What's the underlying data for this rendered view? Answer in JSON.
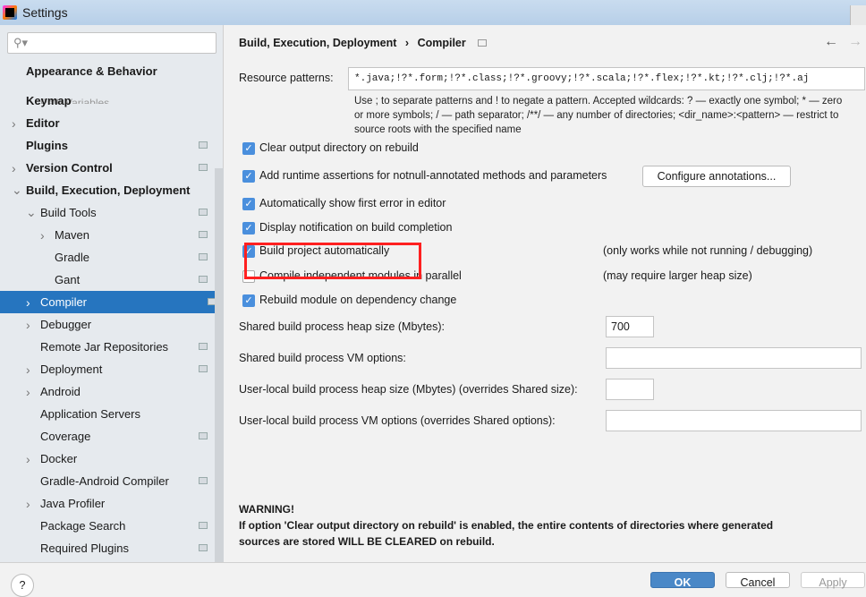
{
  "window": {
    "title": "Settings"
  },
  "sidebar": {
    "search_placeholder": "",
    "ghost": "Path Variables",
    "items": [
      {
        "label": "Appearance & Behavior",
        "bold": true,
        "indent": 0,
        "arrow": false,
        "icon": false
      },
      {
        "label": "Keymap",
        "bold": true,
        "indent": 0,
        "arrow": false,
        "icon": false
      },
      {
        "label": "Editor",
        "bold": true,
        "indent": 0,
        "arrow": "right",
        "icon": false
      },
      {
        "label": "Plugins",
        "bold": true,
        "indent": 0,
        "arrow": false,
        "icon": true
      },
      {
        "label": "Version Control",
        "bold": true,
        "indent": 0,
        "arrow": "right",
        "icon": true
      },
      {
        "label": "Build, Execution, Deployment",
        "bold": true,
        "indent": 0,
        "arrow": "down",
        "icon": false
      },
      {
        "label": "Build Tools",
        "indent": 1,
        "arrow": "down",
        "icon": true
      },
      {
        "label": "Maven",
        "indent": 2,
        "arrow": "right",
        "icon": true
      },
      {
        "label": "Gradle",
        "indent": 2,
        "arrow": false,
        "icon": true
      },
      {
        "label": "Gant",
        "indent": 2,
        "arrow": false,
        "icon": true
      },
      {
        "label": "Compiler",
        "indent": 1,
        "arrow": "right",
        "icon": true,
        "selected": true
      },
      {
        "label": "Debugger",
        "indent": 1,
        "arrow": "right",
        "icon": false
      },
      {
        "label": "Remote Jar Repositories",
        "indent": 1,
        "arrow": false,
        "icon": true
      },
      {
        "label": "Deployment",
        "indent": 1,
        "arrow": "right",
        "icon": true
      },
      {
        "label": "Android",
        "indent": 1,
        "arrow": "right",
        "icon": false
      },
      {
        "label": "Application Servers",
        "indent": 1,
        "arrow": false,
        "icon": false
      },
      {
        "label": "Coverage",
        "indent": 1,
        "arrow": false,
        "icon": true
      },
      {
        "label": "Docker",
        "indent": 1,
        "arrow": "right",
        "icon": false
      },
      {
        "label": "Gradle-Android Compiler",
        "indent": 1,
        "arrow": false,
        "icon": true
      },
      {
        "label": "Java Profiler",
        "indent": 1,
        "arrow": "right",
        "icon": false
      },
      {
        "label": "Package Search",
        "indent": 1,
        "arrow": false,
        "icon": true
      },
      {
        "label": "Required Plugins",
        "indent": 1,
        "arrow": false,
        "icon": true
      }
    ]
  },
  "breadcrumb": {
    "parent": "Build, Execution, Deployment",
    "sep": "›",
    "current": "Compiler"
  },
  "resource": {
    "label": "Resource patterns:",
    "value": "*.java;!?*.form;!?*.class;!?*.groovy;!?*.scala;!?*.flex;!?*.kt;!?*.clj;!?*.aj",
    "help": [
      "Use ; to separate patterns and ! to negate a pattern. Accepted wildcards: ? — exactly one symbol; * — zero",
      "or more symbols; / — path separator; /**/ — any number of directories;  <dir_name>:<pattern> — restrict to",
      "source roots with the specified name"
    ]
  },
  "options": [
    {
      "label": "Clear output directory on rebuild",
      "checked": true
    },
    {
      "label": "Add runtime assertions for notnull-annotated methods and parameters",
      "checked": true
    },
    {
      "label": "Automatically show first error in editor",
      "checked": true
    },
    {
      "label": "Display notification on build completion",
      "checked": true
    },
    {
      "label": "Build project automatically",
      "checked": true,
      "note": "(only works while not running / debugging)"
    },
    {
      "label": "Compile independent modules in parallel",
      "checked": false,
      "note": "(may require larger heap size)"
    },
    {
      "label": "Rebuild module on dependency change",
      "checked": true
    }
  ],
  "configure_button": "Configure annotations...",
  "fields": [
    {
      "label": "Shared build process heap size (Mbytes):",
      "value": "700"
    },
    {
      "label": "Shared build process VM options:",
      "value": ""
    },
    {
      "label": "User-local build process heap size (Mbytes) (overrides Shared size):",
      "value": ""
    },
    {
      "label": "User-local build process VM options (overrides Shared options):",
      "value": ""
    }
  ],
  "warning": {
    "title": "WARNING!",
    "lines": [
      "If option 'Clear output directory on rebuild' is enabled, the entire contents of directories where generated",
      "sources are stored WILL BE CLEARED on rebuild."
    ]
  },
  "buttons": {
    "help": "?",
    "ok": "OK",
    "cancel": "Cancel",
    "apply": "Apply"
  },
  "colors": {
    "selection": "#2675bf",
    "highlight": "#ff2020",
    "ok": "#4a88c7"
  }
}
